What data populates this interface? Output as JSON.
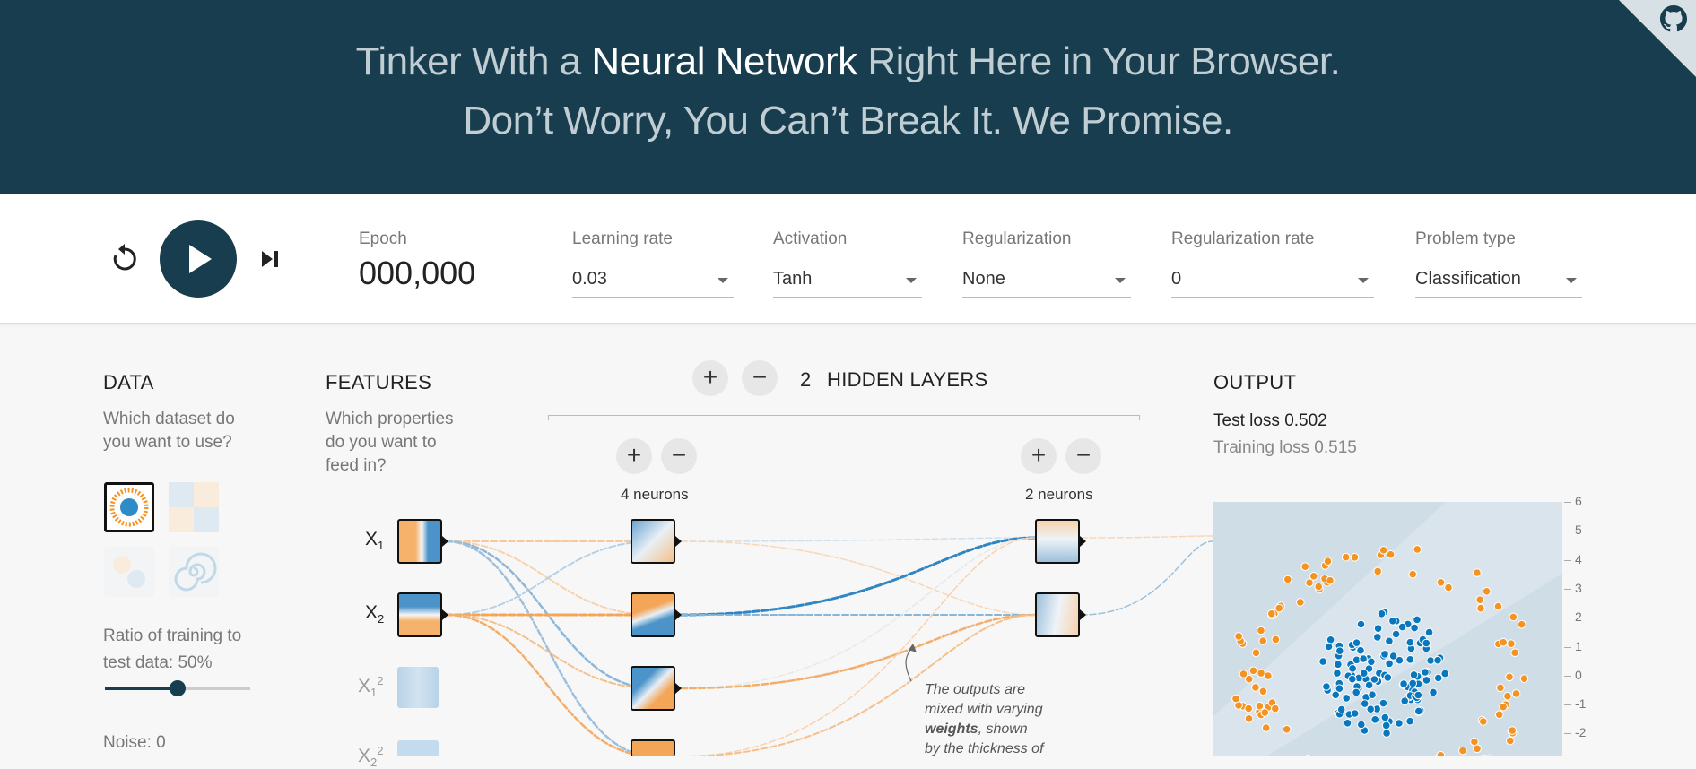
{
  "header": {
    "line1_pre": "Tinker With a ",
    "line1_bold": "Neural Network",
    "line1_post": " Right Here in Your Browser.",
    "line2": "Don’t Worry, You Can’t Break It. We Promise."
  },
  "controls": {
    "epoch_label": "Epoch",
    "epoch_value": "000,000",
    "learning_rate": {
      "label": "Learning rate",
      "value": "0.03"
    },
    "activation": {
      "label": "Activation",
      "value": "Tanh"
    },
    "regularization": {
      "label": "Regularization",
      "value": "None"
    },
    "regularization_rate": {
      "label": "Regularization rate",
      "value": "0"
    },
    "problem_type": {
      "label": "Problem type",
      "value": "Classification"
    }
  },
  "data_panel": {
    "title": "DATA",
    "desc_line1": "Which dataset do",
    "desc_line2": "you want to use?",
    "ratio_line1": "Ratio of training to",
    "ratio_line2": "test data:  50%",
    "ratio_value": 0.5,
    "noise_label": "Noise:  0"
  },
  "features_panel": {
    "title": "FEATURES",
    "desc_line1": "Which properties",
    "desc_line2": "do you want to",
    "desc_line3": "feed in?",
    "features": [
      "X",
      "X",
      "X",
      "X"
    ],
    "subs": [
      "1",
      "2",
      "1",
      "2"
    ],
    "sups": [
      "",
      "",
      "2",
      "2"
    ]
  },
  "hidden_layers": {
    "plus": "+",
    "minus": "−",
    "count": "2",
    "label": "HIDDEN LAYERS",
    "layer1_neurons": "4 neurons",
    "layer2_neurons": "2 neurons"
  },
  "annotation": {
    "line1": "The outputs are",
    "line2": "mixed with varying",
    "line3_bold": "weights",
    "line3_rest": ", shown",
    "line4": "by the thickness of"
  },
  "output_panel": {
    "title": "OUTPUT",
    "test_loss": "Test loss 0.502",
    "training_loss": "Training loss 0.515",
    "y_ticks": [
      "6",
      "5",
      "4",
      "3",
      "2",
      "1",
      "0",
      "-1",
      "-2"
    ]
  },
  "colors": {
    "header_bg": "#183d4e",
    "blue": "#0877bd",
    "orange": "#f59322"
  }
}
